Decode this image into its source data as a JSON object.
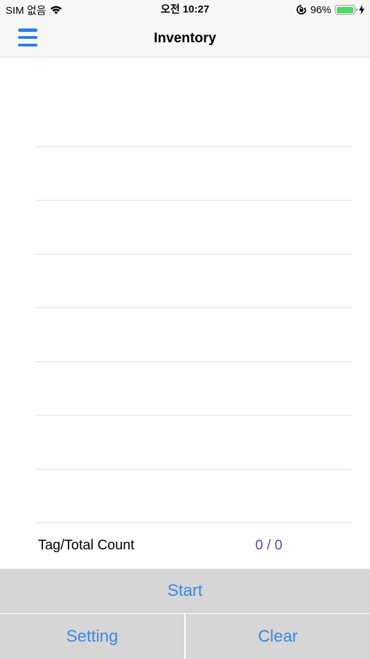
{
  "status_bar": {
    "carrier": "SIM 없음",
    "time": "오전 10:27",
    "battery_percent": "96%",
    "battery_level": 0.96,
    "icons": [
      "wifi-icon",
      "orientation-lock-icon",
      "battery-icon",
      "charging-bolt-icon"
    ]
  },
  "nav": {
    "title": "Inventory",
    "menu_icon": "hamburger-menu-icon",
    "accent_color": "#2b7de9"
  },
  "list": {
    "rows": [
      "",
      "",
      "",
      "",
      "",
      "",
      "",
      ""
    ]
  },
  "count": {
    "label": "Tag/Total Count",
    "value": "0 / 0",
    "value_color": "#6a3ea1"
  },
  "buttons": {
    "start": "Start",
    "setting": "Setting",
    "clear": "Clear",
    "background": "#d6d6d6",
    "text_color": "#3a87ea"
  }
}
